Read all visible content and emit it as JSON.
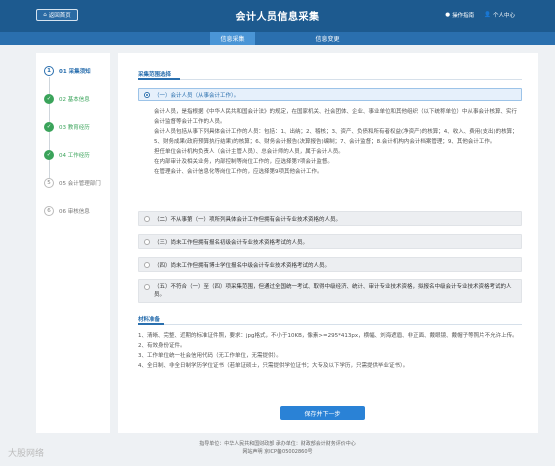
{
  "header": {
    "home_label": "返回首页",
    "title": "会计人员信息采集",
    "guide_label": "操作指南",
    "user_label": "个人中心"
  },
  "tabs": [
    {
      "label": "信息采集"
    },
    {
      "label": "信息变更"
    }
  ],
  "steps": [
    {
      "label": "01 采集须知"
    },
    {
      "label": "02 基本信息"
    },
    {
      "label": "03 教育经历"
    },
    {
      "label": "04 工作经历"
    },
    {
      "label": "05 会计管理部门"
    },
    {
      "label": "06 审核信息"
    }
  ],
  "section1": {
    "title": "采集范围选择"
  },
  "options": [
    {
      "label": "（一）会计人员（从事会计工作）。"
    },
    {
      "label": "（二）不从事第（一）项所列具体会计工作但拥有会计专业技术资格的人员。"
    },
    {
      "label": "（三）尚未工作但拥有报名初级会计专业技术资格考试的人员。"
    },
    {
      "label": "（四）尚未工作但拥有博士学位报名中级会计专业技术资格考试的人员。"
    },
    {
      "label": "（五）不符合（一）至（四）项采集范围，但通过全国统一考试、取得中级经济、统计、审计专业技术资格，拟报名中级会计专业技术资格考试的人员。"
    }
  ],
  "description": [
    "会计人员，是指根据《中华人民共和国会计法》的规定，在国家机关、社会团体、企业、事业单位和其他组织（以下统称单位）中从事会计核算、实行会计监督等会计工作的人员。",
    "会计人员包括从事下列具体会计工作的人员：包括：1、出纳；2、稽核；3、资产、负债和所有者权益(净资产)的核算；4、收入、费用(支出)的核算；5、财务成果(政府预算执行结果)的核算；6、财务会计报告(决算报告)编制；7、会计监督；8.会计机构内会计档案管理；9、其他会计工作。",
    "担任单位会计机构负责人（会计主管人员）、总会计师的人员，属于会计人员。",
    "在内部审计及相关业务，内部控制等岗位工作的，应选择第?项会计监督。",
    "在管理会计、会计信息化等岗位工作的，应选择第9项其他会计工作。"
  ],
  "section2": {
    "title": "材料准备"
  },
  "materials": [
    "1、清晰、完整、近期的标准证件照，要求：jpg格式，不小于10KB，像素>=295*413px，横幅、刘海遮眉、非正面、戴眼镜、戴帽子等照片不允许上传。",
    "2、有效身份证件。",
    "3、工作单位统一社会信用代码（无工作单位，无需提供）。",
    "4、全日制、非全日制学历学位证书（若单证硕士，只需提供学位证书；大专及以下学历，只需提供毕业证书）。"
  ],
  "save_label": "保存并下一步",
  "footer": {
    "line1": "指导单位：中华人民共和国财政部    承办单位：财政部会计财务评价中心",
    "line2": "网站声明    京ICP备05002860号"
  },
  "watermark": "大股网络"
}
